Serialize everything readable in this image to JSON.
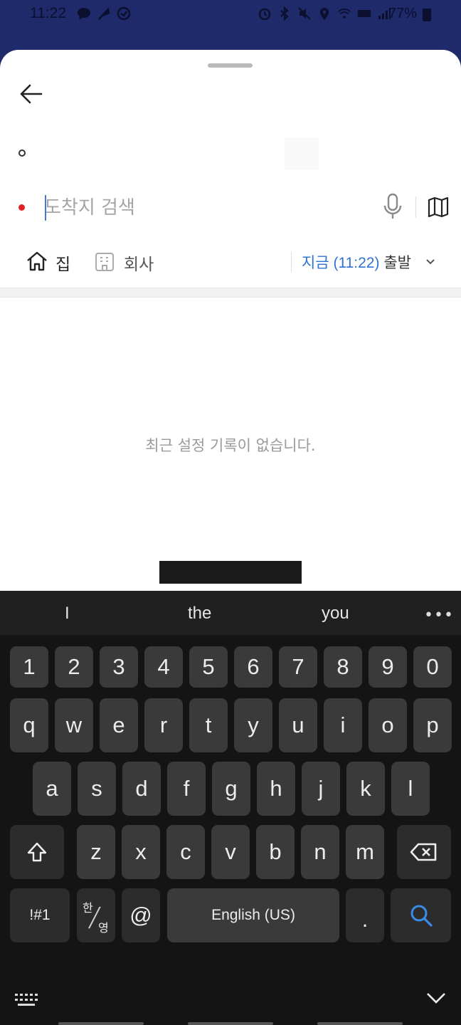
{
  "status_bar": {
    "time": "11:22",
    "battery": "77%",
    "left_icons": [
      "chat-bubble-icon",
      "feather-icon",
      "badge-icon"
    ],
    "right_icons": [
      "alarm-icon",
      "bluetooth-icon",
      "mute-icon",
      "location-icon",
      "wifi-icon",
      "volte-icon",
      "signal-icon"
    ]
  },
  "route_sheet": {
    "destination": {
      "placeholder": "도착지 검색",
      "value": ""
    },
    "quick_places": {
      "home_label": "집",
      "office_label": "회사"
    },
    "departure": {
      "time_text": "지금 (11:22)",
      "suffix": "출발"
    },
    "empty_message": "최근 설정 기록이 없습니다."
  },
  "keyboard": {
    "suggestions": [
      "I",
      "the",
      "you"
    ],
    "more_label": "•••",
    "row_numbers": [
      "1",
      "2",
      "3",
      "4",
      "5",
      "6",
      "7",
      "8",
      "9",
      "0"
    ],
    "row1": [
      "q",
      "w",
      "e",
      "r",
      "t",
      "y",
      "u",
      "i",
      "o",
      "p"
    ],
    "row2": [
      "a",
      "s",
      "d",
      "f",
      "g",
      "h",
      "j",
      "k",
      "l"
    ],
    "row3": [
      "z",
      "x",
      "c",
      "v",
      "b",
      "n",
      "m"
    ],
    "symbols_label": "!#1",
    "lang_top": "한",
    "lang_bottom": "영",
    "at_label": "@",
    "space_label": "English (US)",
    "period_label": ".",
    "accent_color": "#3b8be8"
  }
}
